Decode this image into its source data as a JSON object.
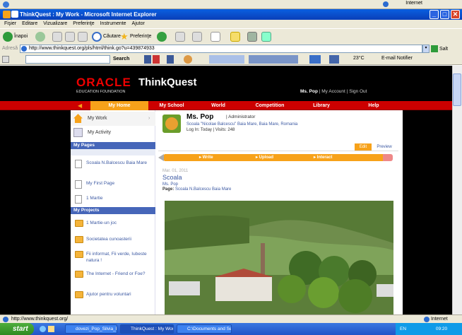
{
  "top_strip": {
    "zone": "Internet"
  },
  "window": {
    "title": "ThinkQuest : My Work - Microsoft Internet Explorer"
  },
  "menu": [
    "Fişier",
    "Editare",
    "Vizualizare",
    "Preferinţe",
    "Instrumente",
    "Ajutor"
  ],
  "toolbar": {
    "back": "Înapoi",
    "search": "Căutare",
    "favorites": "Preferinţe"
  },
  "address": {
    "label": "Adresă",
    "url": "http://www.thinkquest.org/pls/html/think.go?u=439874933",
    "go": "Salt"
  },
  "links_bar": {
    "search_btn": "Search",
    "weather": "23°C",
    "email": "E-mail Notifier"
  },
  "site": {
    "brand": "ORACLE",
    "foundation": "EDUCATION FOUNDATION",
    "product": "ThinkQuest",
    "user": "Ms. Pop",
    "account": "My Account",
    "signout": "Sign Out",
    "sep": "|"
  },
  "nav": [
    "My Home",
    "My School",
    "World",
    "Competition",
    "Library",
    "Help"
  ],
  "sidebar": {
    "my_work": "My Work",
    "my_activity": "My Activity",
    "pages_title": "My Pages",
    "pages": [
      "Scoala N.Balcescu Baia Mare",
      "My First Page",
      "1 Martie"
    ],
    "projects_title": "My Projects",
    "projects": [
      "1 Martie-un joc",
      "Societatea cunoasterii",
      "Fii informat, Fii verde, Iubeste natura !",
      "The Internet - Friend or Foe?",
      "Ajutor pentru voluntari"
    ]
  },
  "profile": {
    "name": "Ms. Pop",
    "role": "| Administrator",
    "school": "Scoala \"Nicolae Balcescu\" Baia Mare, Baia Mare, Romania",
    "log": "Log In: Today | Visits: 248"
  },
  "tabs": {
    "edit": "Edit",
    "preview": "Preview"
  },
  "pencil": {
    "write": "▸ Write",
    "upload": "▸ Upload",
    "interact": "▸ Interact"
  },
  "post": {
    "date": "Mar. 01, 2011",
    "title": "Scoala",
    "author": "Ms. Pop",
    "page_label": "Page:",
    "page_link": "Scoala N.Balcescu Baia Mare"
  },
  "status": {
    "url": "http://www.thinkquest.org/",
    "zone": "Internet"
  },
  "taskbar": {
    "start": "start",
    "tasks": [
      "dovezi_Pop_Silvia_B...",
      "ThinkQuest : My Wor...",
      "C:\\Documents and Se..."
    ],
    "lang": "EN",
    "time": "09:20"
  },
  "colors": {
    "nav_red": "#cc0000",
    "active_orange": "#f7a21a",
    "link_blue": "#3d5aa3",
    "section_blue": "#4666b9"
  }
}
